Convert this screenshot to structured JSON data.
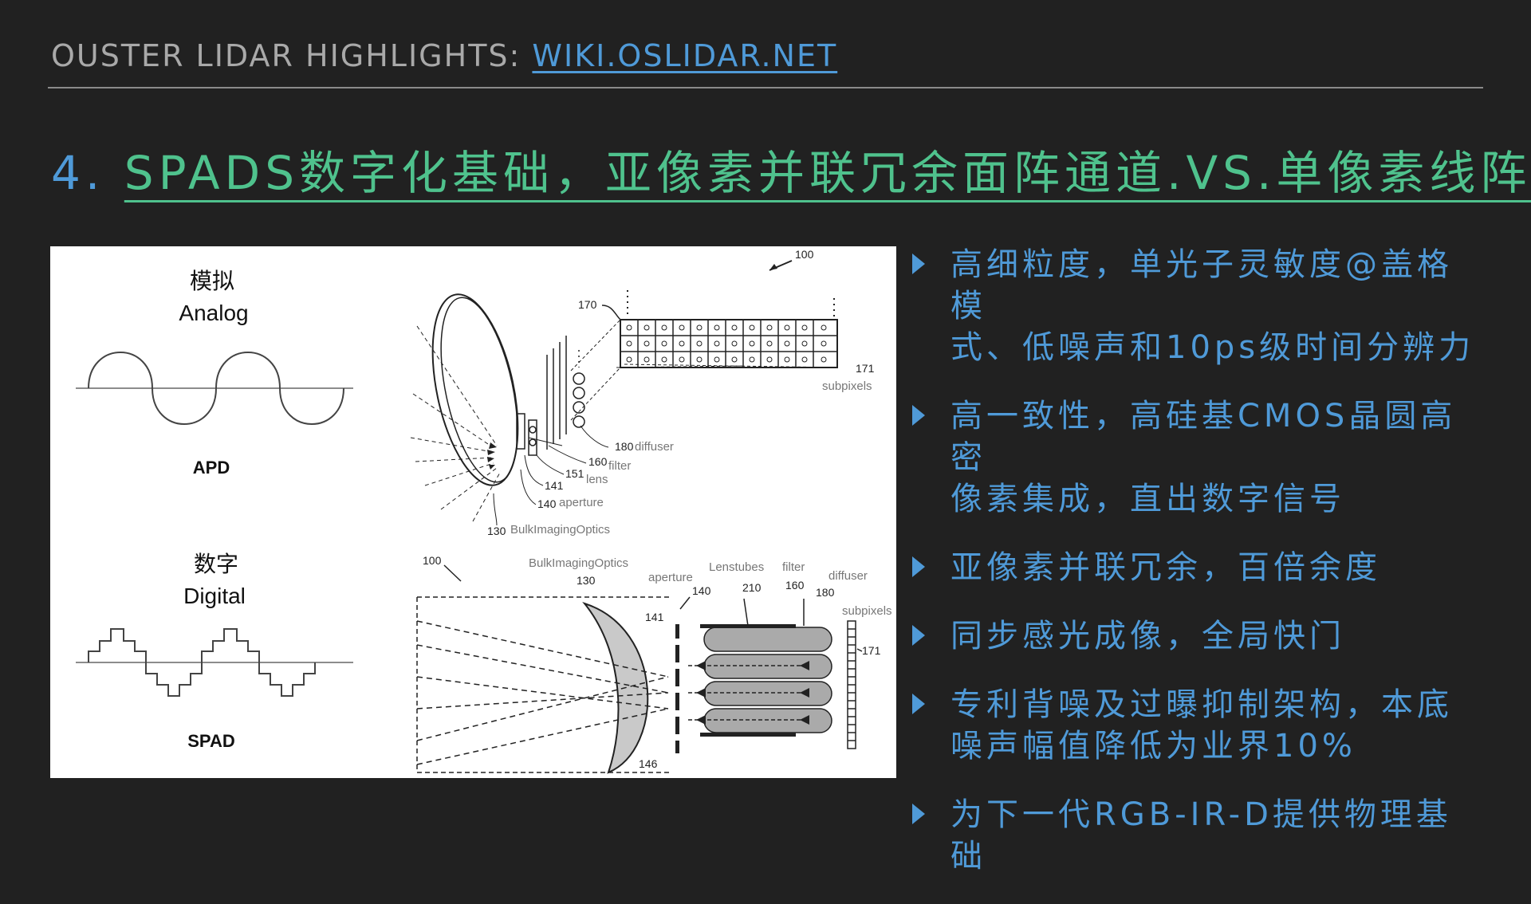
{
  "header": {
    "prefix": "OUSTER LIDAR HIGHLIGHTS: ",
    "link": "WIKI.OSLIDAR.NET"
  },
  "title": {
    "number": "4.",
    "text": "SPADS数字化基础，亚像素并联冗余面阵通道.VS.单像素线阵"
  },
  "figure": {
    "analog": {
      "cn": "模拟",
      "en": "Analog",
      "device": "APD"
    },
    "digital": {
      "cn": "数字",
      "en": "Digital",
      "device": "SPAD"
    },
    "patent_top": {
      "ref": "100",
      "ref_170": "170",
      "ref_171": "171",
      "subpixels": "subpixels",
      "ref_180": "180",
      "diffuser": "diffuser",
      "ref_160": "160",
      "filter": "filter",
      "ref_151": "151",
      "lens": "lens",
      "ref_141": "141",
      "ref_140": "140",
      "aperture": "aperture",
      "ref_130": "130",
      "optics": "BulkImagingOptics"
    },
    "patent_bottom": {
      "ref": "100",
      "optics": "BulkImagingOptics",
      "ref_130": "130",
      "aperture": "aperture",
      "ref_140": "140",
      "lenstubes": "Lenstubes",
      "ref_210": "210",
      "filter": "filter",
      "ref_160": "160",
      "diffuser": "diffuser",
      "ref_180": "180",
      "subpixels": "subpixels",
      "ref_141": "141",
      "ref_171": "171",
      "ref_146": "146"
    }
  },
  "bullets": [
    {
      "line1": "高细粒度，单光子灵敏度@盖格模",
      "line2": "式、低噪声和10ps级时间分辨力"
    },
    {
      "line1": "高一致性，高硅基CMOS晶圆高密",
      "line2": "像素集成，直出数字信号"
    },
    {
      "line1": "亚像素并联冗余，百倍余度",
      "line2": ""
    },
    {
      "line1": "同步感光成像，全局快门",
      "line2": ""
    },
    {
      "line1": "专利背噪及过曝抑制架构，本底",
      "line2": "噪声幅值降低为业界10%"
    },
    {
      "line1": "为下一代RGB-IR-D提供物理基础",
      "line2": ""
    }
  ],
  "colors": {
    "background": "#212121",
    "accent_blue": "#4f9ad8",
    "accent_green": "#4fc28d",
    "header_gray": "#a9a9a9"
  }
}
